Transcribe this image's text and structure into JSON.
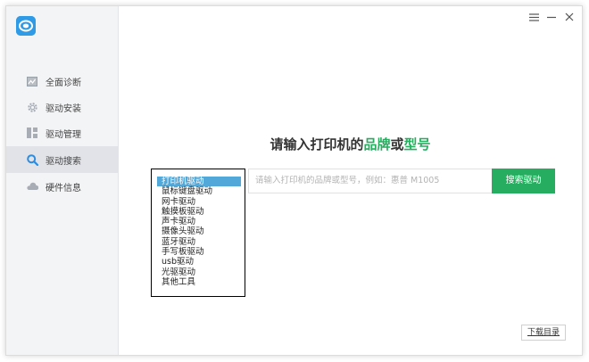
{
  "titlebar": {
    "menu_icon": "menu-icon",
    "minimize_icon": "minimize-icon",
    "close_icon": "close-icon"
  },
  "sidebar": {
    "logo_icon": "app-logo-icon",
    "items": [
      {
        "label": "全面诊断",
        "icon": "diagnosis-icon",
        "active": false
      },
      {
        "label": "驱动安装",
        "icon": "gear-icon",
        "active": false
      },
      {
        "label": "驱动管理",
        "icon": "grid-icon",
        "active": false
      },
      {
        "label": "驱动搜索",
        "icon": "search-icon",
        "active": true
      },
      {
        "label": "硬件信息",
        "icon": "cloud-icon",
        "active": false
      }
    ]
  },
  "main": {
    "headline": {
      "part1": "请输入打印机的",
      "brand": "品牌",
      "or": "或",
      "model": "型号"
    },
    "search": {
      "placeholder": "请输入打印机的品牌或型号，例如：惠普 M1005",
      "button_label": "搜索驱动"
    },
    "dropdown": {
      "selected": "打印机驱动",
      "options": [
        "打印机驱动",
        "鼠标键盘驱动",
        "网卡驱动",
        "触摸板驱动",
        "声卡驱动",
        "摄像头驱动",
        "蓝牙驱动",
        "手写板驱动",
        "usb驱动",
        "光驱驱动",
        "其他工具"
      ]
    },
    "download_label": "下载目录"
  },
  "colors": {
    "accent_green": "#27ad5f",
    "selection_blue": "#52a8d9",
    "logo_blue": "#2f9ae6",
    "sidebar_bg": "#f3f4f6"
  }
}
